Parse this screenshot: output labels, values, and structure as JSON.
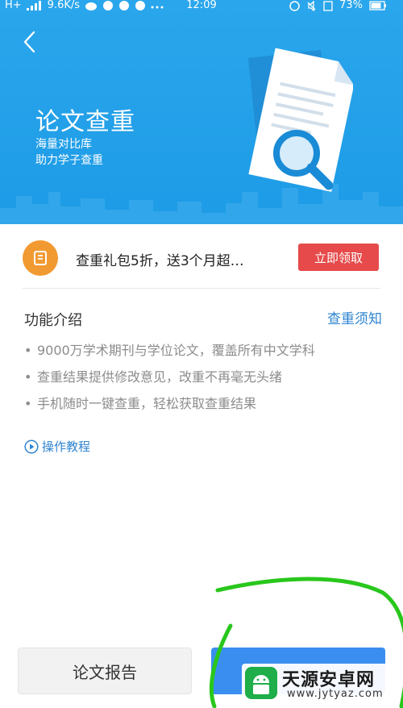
{
  "status_bar": {
    "network": "H+",
    "speed": "9.6K/s",
    "time": "12:09",
    "battery": "73%"
  },
  "header": {
    "title": "论文查重",
    "subtitle_line1": "海量对比库",
    "subtitle_line2": "助力学子查重",
    "bg_color": "#1d9be6"
  },
  "promo": {
    "text": "查重礼包5折，送3个月超…",
    "button_label": "立即领取",
    "icon_color": "#f29a32",
    "button_color": "#e64a4a"
  },
  "features": {
    "title": "功能介绍",
    "notice_link": "查重须知",
    "items": [
      "9000万学术期刊与学位论文，覆盖所有中文学科",
      "查重结果提供修改意见，改重不再毫无头绪",
      "手机随时一键查重，轻松获取查重结果"
    ],
    "tutorial_label": "操作教程",
    "link_color": "#2f84d0"
  },
  "bottom": {
    "report_label": "论文报告",
    "start_button_color": "#3a8ef0"
  },
  "watermark": {
    "title": "天源安卓网",
    "url": "www.jytyaz.com"
  }
}
